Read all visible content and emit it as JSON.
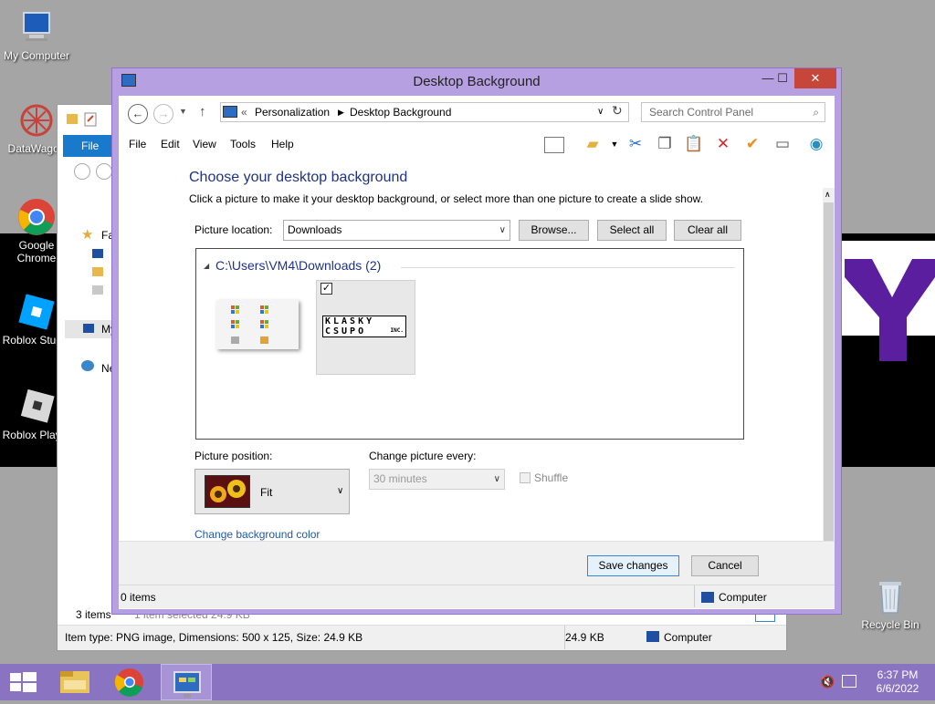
{
  "desktop": {
    "icons": [
      {
        "label": "My Computer"
      },
      {
        "label": "DataWagon"
      },
      {
        "label": "Google Chrome"
      },
      {
        "label": "Roblox Studio"
      },
      {
        "label": "Roblox Player"
      },
      {
        "label": "Recycle Bin"
      }
    ],
    "wallpaper_letter": "Y"
  },
  "explorer_bg": {
    "ribbon_file": "File",
    "nav_fav": "Fa",
    "nav_my": "My",
    "nav_net": "Ne",
    "items_count": "3 items",
    "selected_text": "1 item selected 24.9 KB",
    "status_detail": "Item type: PNG image, Dimensions: 500 x 125, Size: 24.9 KB",
    "status_size": "24.9 KB",
    "status_location": "Computer"
  },
  "window": {
    "title": "Desktop Background",
    "breadcrumb": [
      "Personalization",
      "Desktop Background"
    ],
    "breadcrumb_sep": "«",
    "search_placeholder": "Search Control Panel",
    "menu": [
      "File",
      "Edit",
      "View",
      "Tools",
      "Help"
    ],
    "heading": "Choose your desktop background",
    "subheading": "Click a picture to make it your desktop background, or select more than one picture to create a slide show.",
    "picture_location_label": "Picture location:",
    "picture_location_value": "Downloads",
    "browse_label": "Browse...",
    "select_all_label": "Select all",
    "clear_all_label": "Clear all",
    "group_header": "C:\\Users\\VM4\\Downloads (2)",
    "thumb2_text": "KLASKY CSUPO",
    "thumb2_inc": "INC.",
    "picture_position_label": "Picture position:",
    "picture_position_value": "Fit",
    "change_every_label": "Change picture every:",
    "change_every_value": "30 minutes",
    "shuffle_label": "Shuffle",
    "change_color_link": "Change background color",
    "save_label": "Save changes",
    "cancel_label": "Cancel",
    "status_items": "0 items",
    "status_location": "Computer"
  },
  "taskbar": {
    "time": "6:37 PM",
    "date": "6/6/2022"
  },
  "colors": {
    "window_frame": "#b7a0e2",
    "taskbar": "#8a74c1",
    "close_button": "#c7463a",
    "heading": "#1e3287",
    "link": "#1e5aa8"
  }
}
